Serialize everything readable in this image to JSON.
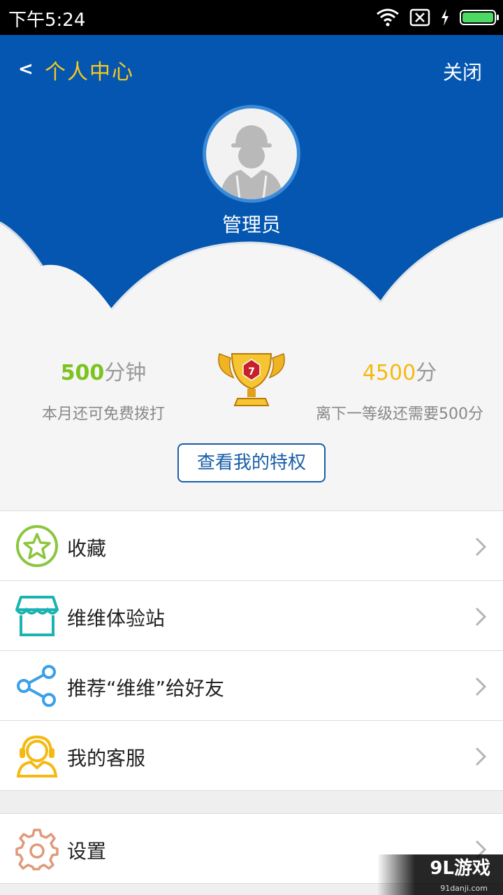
{
  "status_bar": {
    "time": "下午5:24"
  },
  "header": {
    "back_symbol": "<",
    "title": "个人中心",
    "close_label": "关闭"
  },
  "profile": {
    "username": "管理员"
  },
  "stats": {
    "minutes_value": "500",
    "minutes_unit": "分钟",
    "minutes_caption": "本月还可免费拨打",
    "points_value": "4500",
    "points_unit": "分",
    "points_caption": "离下一等级还需要500分",
    "level_badge": "7"
  },
  "privilege_button": "查看我的特权",
  "menu": [
    {
      "label": "收藏",
      "icon": "star-icon",
      "color": "#8cc63f"
    },
    {
      "label": "维维体验站",
      "icon": "shop-icon",
      "color": "#1ab3b3"
    },
    {
      "label": "推荐“维维”给好友",
      "icon": "share-icon",
      "color": "#3aa0e8"
    },
    {
      "label": "我的客服",
      "icon": "customer-service-icon",
      "color": "#f5b911"
    }
  ],
  "settings": {
    "label": "设置",
    "icon": "gear-icon",
    "color": "#e09a7a"
  },
  "watermark": {
    "brand": "9L游戏",
    "site": "91danji.com"
  },
  "colors": {
    "header_blue": "#0456b0",
    "title_yellow": "#f8c81c",
    "cloud": "#f5f5f5"
  }
}
